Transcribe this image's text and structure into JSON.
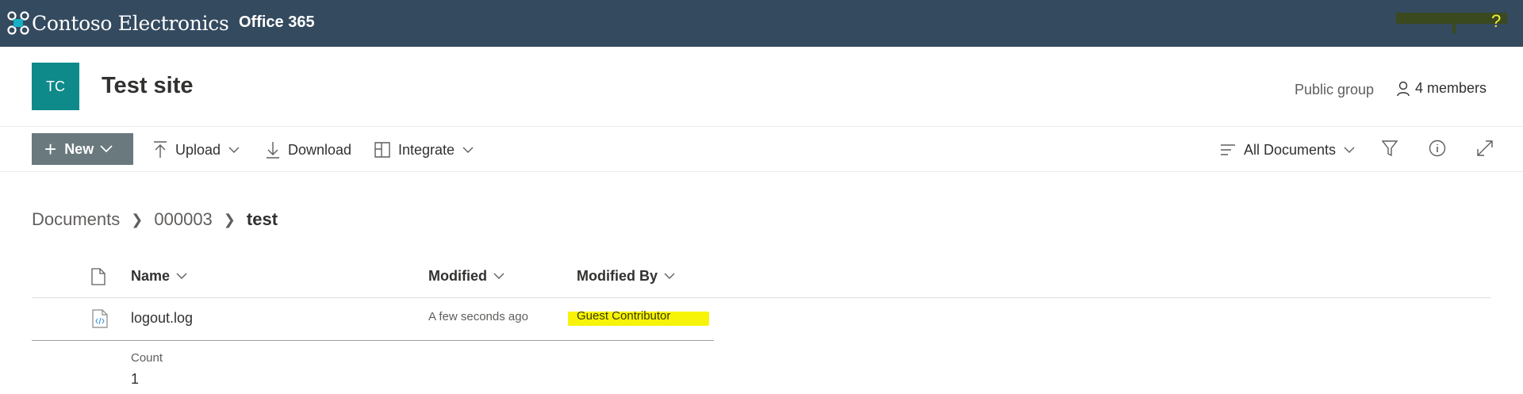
{
  "suite": {
    "brand": "Contoso Electronics",
    "product": "Office 365",
    "help": "?"
  },
  "site": {
    "logo_initials": "TC",
    "title": "Test site",
    "group_type": "Public group",
    "members": "4 members"
  },
  "commands": {
    "new": "New",
    "upload": "Upload",
    "download": "Download",
    "integrate": "Integrate",
    "view": "All Documents"
  },
  "breadcrumb": [
    "Documents",
    "000003",
    "test"
  ],
  "table": {
    "columns": {
      "name": "Name",
      "modified": "Modified",
      "modified_by": "Modified By"
    },
    "rows": [
      {
        "name": "logout.log",
        "modified": "A few seconds ago",
        "modified_by": "Guest Contributor"
      }
    ],
    "count_label": "Count",
    "count_value": "1"
  },
  "colors": {
    "suitebar": "#344a5f",
    "site_logo": "#0e8a8a",
    "new_button": "#69797e",
    "highlight": "#f7f309"
  }
}
